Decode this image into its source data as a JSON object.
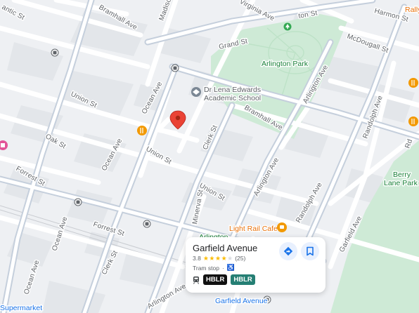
{
  "map": {
    "colors": {
      "background": "#eef0f3",
      "road": "#ffffff",
      "major_road": "#c5cfdc",
      "park": "#ceead6",
      "building": "#e3e6ea"
    },
    "road_labels": {
      "atlantic_st": "antic St",
      "bramhall_ave_top": "Bramhall Ave",
      "madison": "Madison",
      "virginia_ave": "Virginia Ave",
      "clinton_st": "ton St",
      "harmon_st": "Harmon St",
      "grand_st": "Grand St",
      "mcdougall_st": "McDougall St",
      "union_st_left": "Union St",
      "ocean_ave_upper": "Ocean Ave",
      "clerk_st_upper": "Clerk St",
      "bramhall_ave_mid": "Bramhall Ave",
      "arlington_ave_right": "Arlington Ave",
      "randolph_ave_upper": "Randolph Ave",
      "oak_st": "Oak St",
      "ocean_ave_mid": "Ocean Ave",
      "union_st_mid": "Union St",
      "forrest_st_left": "Forrest St",
      "arlington_ave_mid": "Arlington Ave",
      "union_st_lower": "Union St",
      "randolph_ave_mid": "Randolph Ave",
      "ocean_ave_lower": "Ocean Ave",
      "forrest_st_lower": "Forrest St",
      "minerva_st": "Minerva St",
      "ocean_ave_bottom": "Ocean Ave",
      "clerk_st_lower": "Clerk St",
      "arlington_ave_bottom": "Arlington Ave",
      "garfield_ave_right": "Garfield Ave",
      "rd_edge": "Rd"
    },
    "pois": {
      "arlington_park": "Arlington Park",
      "school_line1": "Dr Lena Edwards",
      "school_line2": "Academic School",
      "berry_lane_line1": "Berry",
      "berry_lane_line2": "Lane Park",
      "light_rail_cafe": "Light Rail Cafe",
      "garfield_station": "Garfield Avenue",
      "supermarket": "Supermarket",
      "rally": "Rally",
      "arlington_partial": "Arlington"
    },
    "icons": {
      "selected_pin": "red-pin-icon",
      "restaurant": "fork-knife-icon",
      "school": "school-icon",
      "transit": "tram-station-icon"
    }
  },
  "place_card": {
    "title": "Garfield Avenue",
    "rating": "3.8",
    "stars_filled": 4,
    "stars_total": 5,
    "review_count": "(25)",
    "type": "Tram stop",
    "separator": "·",
    "lines": [
      "HBLR",
      "HBLR"
    ],
    "line_colors": [
      "#111111",
      "#257f74"
    ],
    "directions_icon": "directions-icon",
    "save_icon": "bookmark-icon"
  }
}
